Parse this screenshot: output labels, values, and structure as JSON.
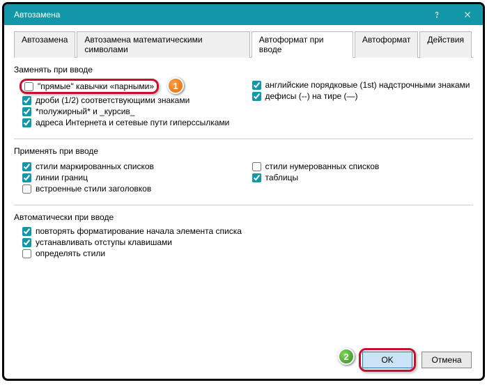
{
  "window": {
    "title": "Автозамена"
  },
  "tabs": {
    "autoreplace": "Автозамена",
    "math": "Автозамена математическими символами",
    "autoformat_type": "Автоформат при вводе",
    "autoformat": "Автоформат",
    "actions": "Действия"
  },
  "sections": {
    "replace": {
      "heading": "Заменять при вводе",
      "quotes": "\"прямые\" кавычки «парными»",
      "fractions": "дроби (1/2) соответствующими знаками",
      "bold_italic": "*полужирный* и _курсив_",
      "hyperlinks": "адреса Интернета и сетевые пути гиперссылками",
      "ordinals": "английские порядковые (1st) надстрочными знаками",
      "dashes": "дефисы (--) на тире (—)"
    },
    "apply": {
      "heading": "Применять при вводе",
      "bulleted": "стили маркированных списков",
      "borders": "линии границ",
      "builtin_heading": "встроенные стили заголовков",
      "numbered": "стили нумерованных списков",
      "tables": "таблицы"
    },
    "auto": {
      "heading": "Автоматически при вводе",
      "repeat_format": "повторять форматирование начала элемента списка",
      "tab_indent": "устанавливать отступы клавишами",
      "define_styles": "определять стили"
    }
  },
  "markers": {
    "one": "1",
    "two": "2"
  },
  "footer": {
    "ok": "OK",
    "cancel": "Отмена"
  }
}
